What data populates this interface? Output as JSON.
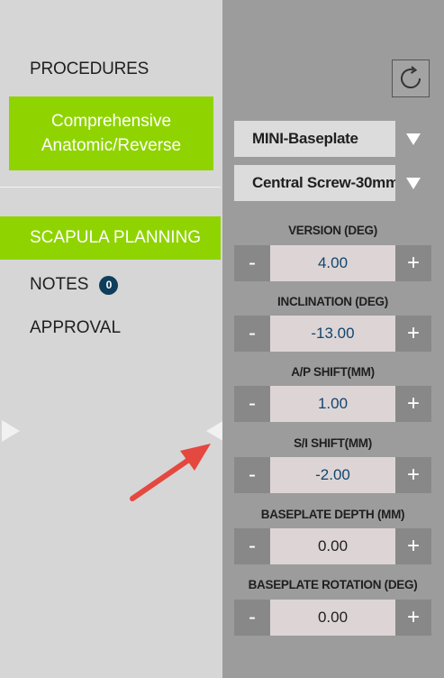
{
  "sidebar": {
    "procedures_title": "PROCEDURES",
    "procedure_button": "Comprehensive Anatomic/Reverse",
    "nav": [
      {
        "label": "SCAPULA PLANNING",
        "active": true
      },
      {
        "label": "NOTES",
        "badge": "0"
      },
      {
        "label": "APPROVAL"
      }
    ]
  },
  "panel": {
    "refresh_icon": "refresh-icon",
    "baseplate_select": "MINI-Baseplate",
    "screw_select": "Central Screw-30mm",
    "params": [
      {
        "label": "VERSION (DEG)",
        "value": "4.00",
        "minus": "-",
        "plus": "+"
      },
      {
        "label": "INCLINATION (DEG)",
        "value": "-13.00",
        "minus": "-",
        "plus": "+"
      },
      {
        "label": "A/P SHIFT(MM)",
        "value": "1.00",
        "minus": "-",
        "plus": "+"
      },
      {
        "label": "S/I SHIFT(MM)",
        "value": "-2.00",
        "minus": "-",
        "plus": "+"
      },
      {
        "label": "BASEPLATE DEPTH (MM)",
        "value": "0.00",
        "minus": "-",
        "plus": "+"
      },
      {
        "label": "BASEPLATE ROTATION (DEG)",
        "value": "0.00",
        "minus": "-",
        "plus": "+"
      }
    ]
  },
  "colors": {
    "accent_green": "#8fd400",
    "badge_navy": "#0f3e5c",
    "value_blue": "#12456f",
    "annotation_arrow": "#e5483f"
  }
}
